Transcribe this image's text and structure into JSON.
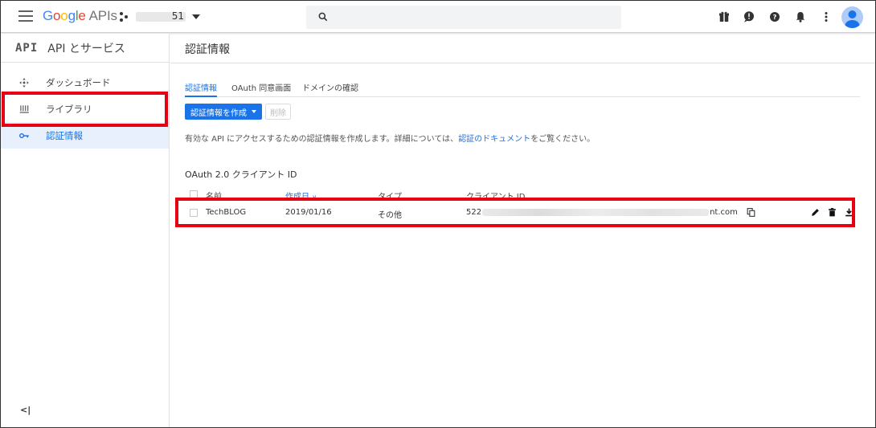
{
  "topbar": {
    "logo_google": [
      "G",
      "o",
      "o",
      "g",
      "l",
      "e"
    ],
    "logo_apis": "APIs",
    "project_suffix": "51"
  },
  "sidebar": {
    "api_badge": "API",
    "title": "API とサービス",
    "items": [
      {
        "label": "ダッシュボード",
        "icon": "dashboard-icon"
      },
      {
        "label": "ライブラリ",
        "icon": "library-icon"
      },
      {
        "label": "認証情報",
        "icon": "key-icon",
        "active": true
      }
    ],
    "collapse_label": "<|"
  },
  "main": {
    "page_title": "認証情報",
    "tabs": [
      {
        "label": "認証情報",
        "active": true
      },
      {
        "label": "OAuth 同意画面"
      },
      {
        "label": "ドメインの確認"
      }
    ],
    "create_button": "認証情報を作成",
    "delete_button": "削除",
    "description_before": "有効な API にアクセスするための認証情報を作成します。詳細については、",
    "description_link": "認証のドキュメント",
    "description_after": "をご覧ください。",
    "section_title": "OAuth 2.0 クライアント ID",
    "table": {
      "headers": [
        "名前",
        "作成日",
        "タイプ",
        "クライアント ID"
      ],
      "rows": [
        {
          "name": "TechBLOG",
          "created": "2019/01/16",
          "type": "その他",
          "client_id_prefix": "522",
          "client_id_suffix": "nt.com"
        }
      ]
    }
  },
  "colors": {
    "accent": "#1a73e8",
    "highlight": "#e60012",
    "active_bg": "#e8f0fe"
  }
}
